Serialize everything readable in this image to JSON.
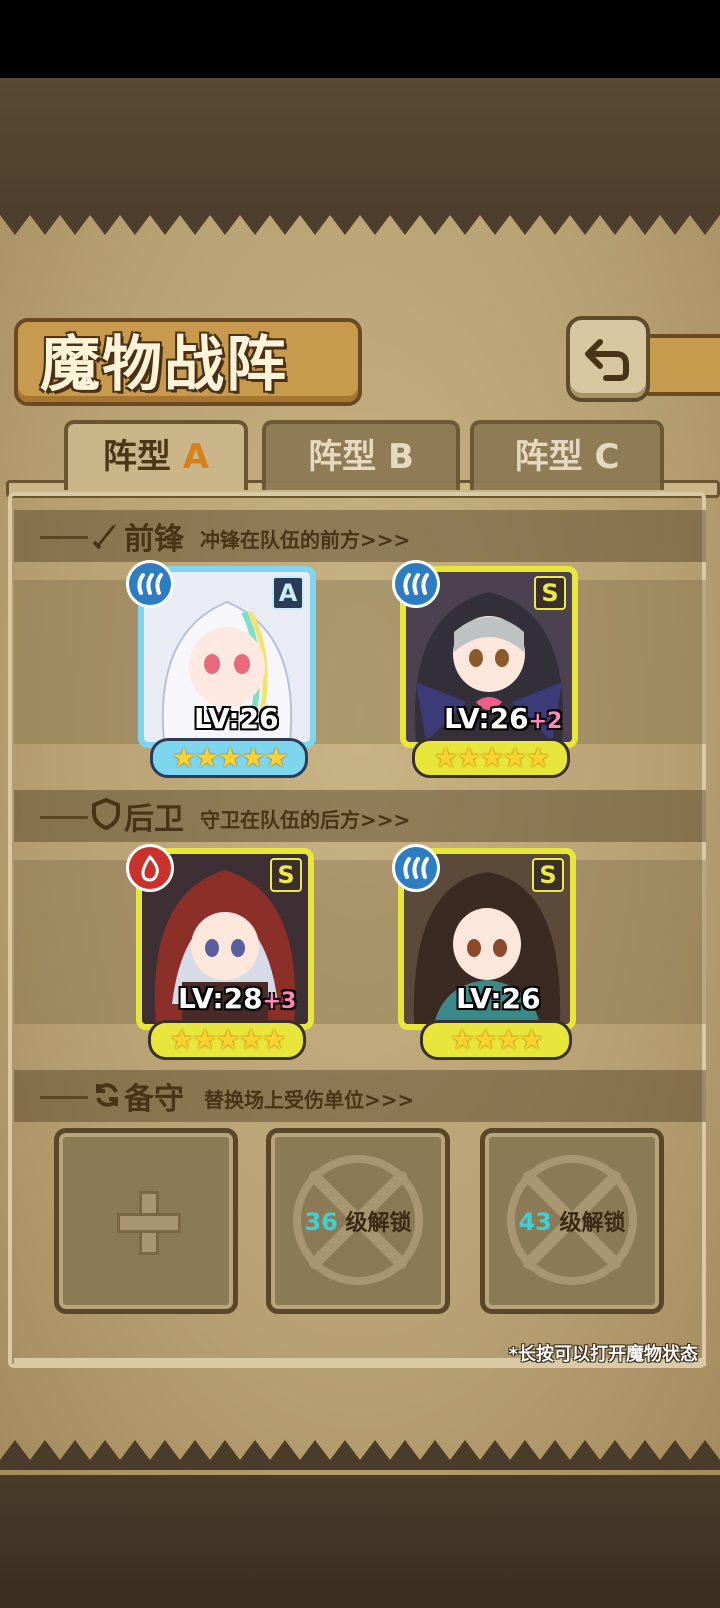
{
  "title": "魔物战阵",
  "tabs": [
    {
      "label": "阵型",
      "suffix": "A",
      "active": true
    },
    {
      "label": "阵型",
      "suffix": "B",
      "active": false
    },
    {
      "label": "阵型",
      "suffix": "C",
      "active": false
    }
  ],
  "sections": {
    "front": {
      "title": "前锋",
      "subtitle": "冲锋在队伍的前方>>>"
    },
    "back": {
      "title": "后卫",
      "subtitle": "守卫在队伍的后方>>>"
    },
    "reserve": {
      "title": "备守",
      "subtitle": "替换场上受伤单位>>>"
    }
  },
  "units": [
    {
      "rarity": "A",
      "element": "water",
      "level": "LV:26",
      "bonus": "",
      "stars": "★★★★★"
    },
    {
      "rarity": "S",
      "element": "water",
      "level": "LV:26",
      "bonus": "+2",
      "stars": "★★★★★"
    },
    {
      "rarity": "S",
      "element": "fire",
      "level": "LV:28",
      "bonus": "+3",
      "stars": "★★★★★"
    },
    {
      "rarity": "S",
      "element": "water",
      "level": "LV:26",
      "bonus": "",
      "stars": "★★★★"
    }
  ],
  "reserve_slots": [
    {
      "state": "empty"
    },
    {
      "state": "locked",
      "unlock_level": "36",
      "unlock_text": "级解锁"
    },
    {
      "state": "locked",
      "unlock_level": "43",
      "unlock_text": "级解锁"
    }
  ],
  "hint": "*长按可以打开魔物状态",
  "colors": {
    "rarity_a": "#7ed6ee",
    "rarity_s": "#e8e63a",
    "water": "#2c7dc2",
    "fire": "#c8312c",
    "accent": "#d8801a"
  }
}
